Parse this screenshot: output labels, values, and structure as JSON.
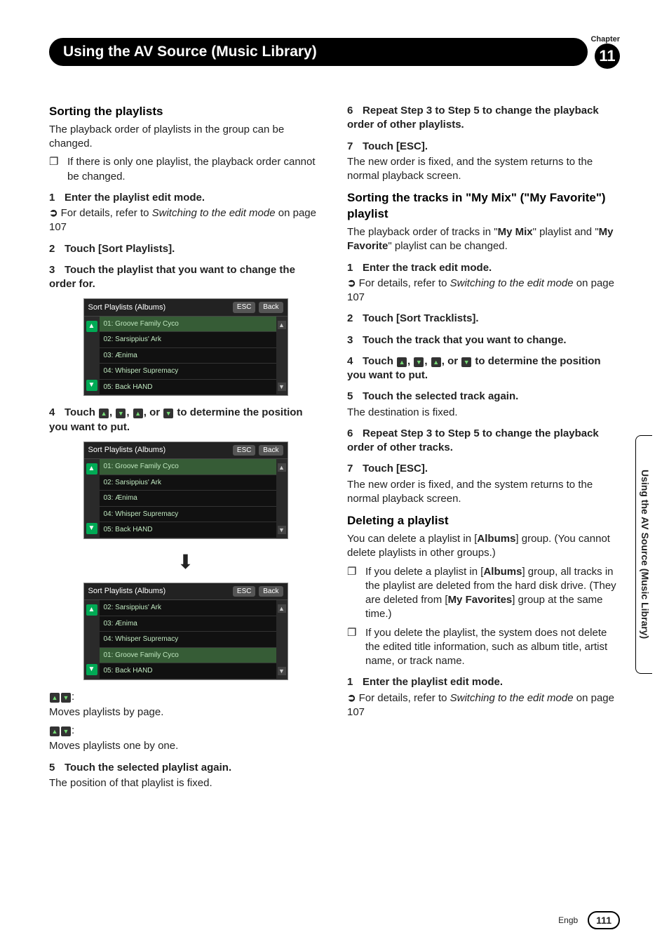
{
  "header": {
    "title": "Using the AV Source (Music Library)",
    "chapter_label": "Chapter",
    "chapter_num": "11"
  },
  "side_tab": "Using the AV Source (Music Library)",
  "footer": {
    "lang": "Engb",
    "page": "111"
  },
  "icons": {
    "page_up": "▲▲",
    "page_down": "▼▼",
    "one_up": "▲",
    "one_down": "▼"
  },
  "left": {
    "h_sort": "Sorting the playlists",
    "p1": "The playback order of playlists in the group can be changed.",
    "note1": "If there is only one playlist, the playback order cannot be changed.",
    "s1": "Enter the playlist edit mode.",
    "ref1a": "For details, refer to ",
    "ref1b": "Switching to the edit mode",
    "ref1c": " on page 107",
    "s2": "Touch [Sort Playlists].",
    "s3": "Touch the playlist that you want to change the order for.",
    "s4a": "Touch ",
    "s4b": ", or ",
    "s4c": " to determine the position you want to put.",
    "icon_desc1": "Moves playlists by page.",
    "icon_desc2": "Moves playlists one by one.",
    "s5": "Touch the selected playlist again.",
    "p5": "The position of that playlist is fixed."
  },
  "right": {
    "s6": "Repeat Step 3 to Step 5 to change the playback order of other playlists.",
    "s7": "Touch [ESC].",
    "p7": "The new order is fixed, and the system returns to the normal playback screen.",
    "h_sort_tracks_a": "Sorting the tracks in \"",
    "h_sort_tracks_b": "My Mix",
    "h_sort_tracks_c": "\" (\"",
    "h_sort_tracks_d": "My Favorite",
    "h_sort_tracks_e": "\") playlist",
    "pt1a": "The playback order of tracks in \"",
    "pt1b": "My Mix",
    "pt1c": "\" playlist and \"",
    "pt1d": "My Favorite",
    "pt1e": "\" playlist can be changed.",
    "ts1": "Enter the track edit mode.",
    "tref1a": "For details, refer to ",
    "tref1b": "Switching to the edit mode",
    "tref1c": " on page 107",
    "ts2": "Touch [Sort Tracklists].",
    "ts3": "Touch the track that you want to change.",
    "ts4a": "Touch ",
    "ts4b": ", or ",
    "ts4c": " to determine the position you want to put.",
    "ts5": "Touch the selected track again.",
    "tp5": "The destination is fixed.",
    "ts6": "Repeat Step 3 to Step 5 to change the playback order of other tracks.",
    "ts7": "Touch [ESC].",
    "tp7": "The new order is fixed, and the system returns to the normal playback screen.",
    "h_delete": "Deleting a playlist",
    "dp1a": "You can delete a playlist in [",
    "dp1b": "Albums",
    "dp1c": "] group. (You cannot delete playlists in other groups.)",
    "dn1a": "If you delete a playlist in [",
    "dn1b": "Albums",
    "dn1c": "] group, all tracks in the playlist are deleted from the hard disk drive. (They are deleted from [",
    "dn1d": "My Favorites",
    "dn1e": "] group at the same time.)",
    "dn2": "If you delete the playlist, the system does not delete the edited title information, such as album title, artist name, or track name.",
    "ds1": "Enter the playlist edit mode.",
    "dref1a": "For details, refer to ",
    "dref1b": "Switching to the edit mode",
    "dref1c": " on page 107"
  },
  "screenshot": {
    "title": "Sort Playlists (Albums)",
    "esc": "ESC",
    "back": "Back",
    "rows_a": [
      "01: Groove Family Cyco",
      "02: Sarsippius' Ark",
      "03: Ænima",
      "04: Whisper Supremacy",
      "05: Back HAND"
    ],
    "rows_b": [
      "01: Groove Family Cyco",
      "02: Sarsippius' Ark",
      "03: Ænima",
      "04: Whisper Supremacy",
      "05: Back HAND"
    ],
    "rows_c": [
      "02: Sarsippius' Ark",
      "03: Ænima",
      "04: Whisper Supremacy",
      "01: Groove Family Cyco",
      "05: Back HAND"
    ]
  }
}
